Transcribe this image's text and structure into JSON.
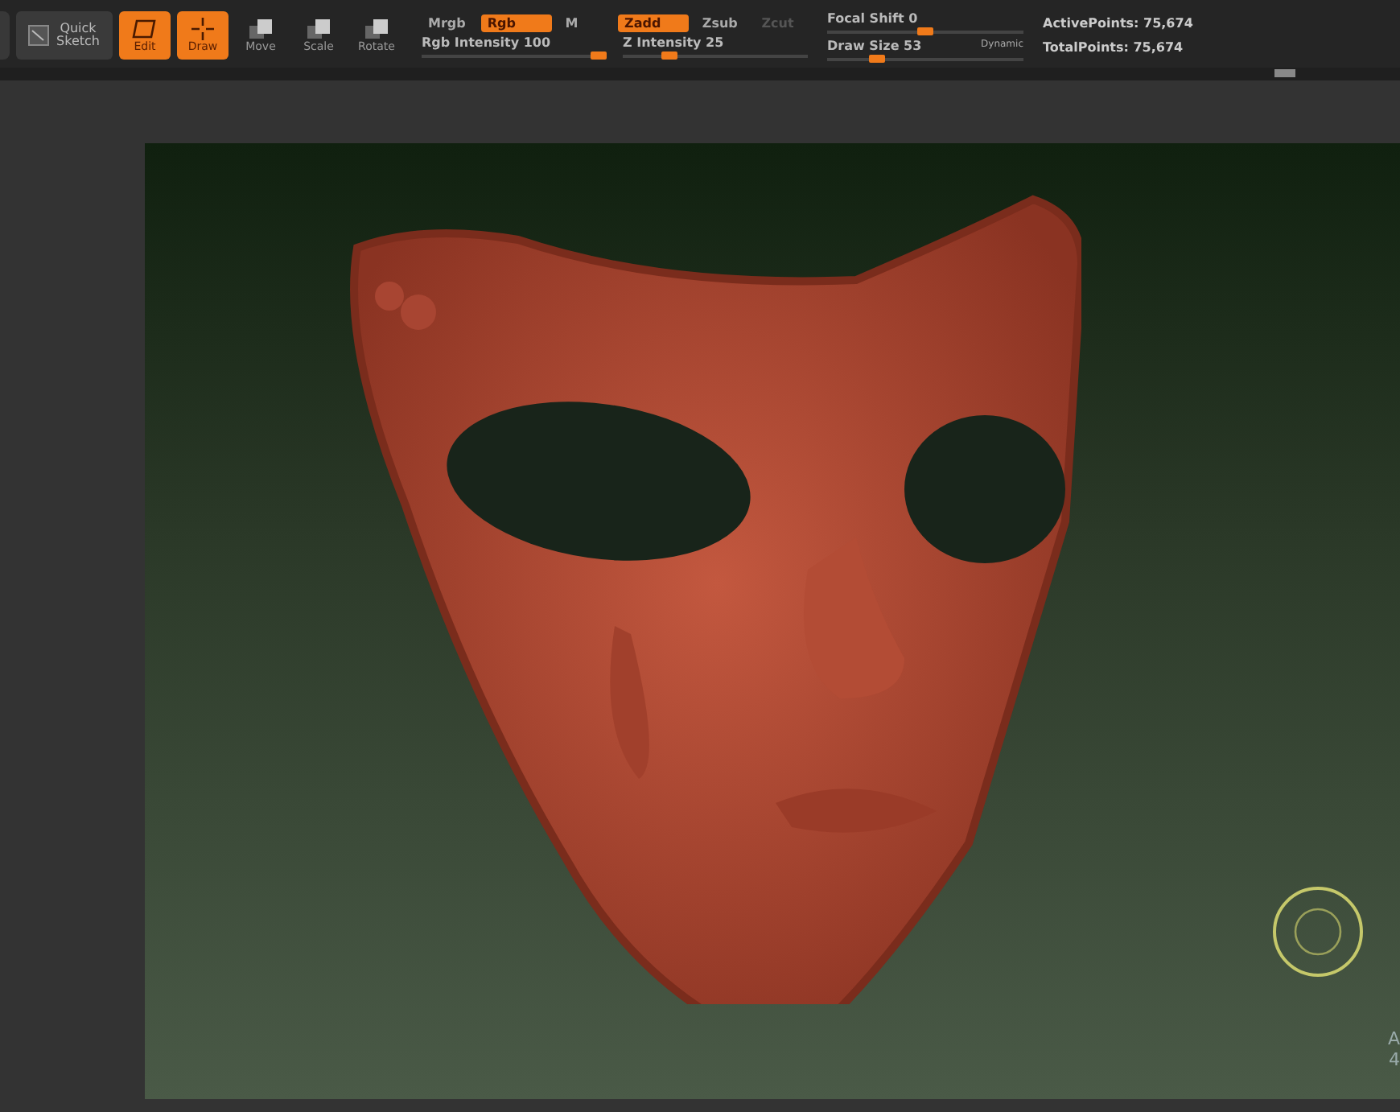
{
  "toolbar": {
    "tools": [
      {
        "label": "Quick Sketch",
        "kind": "sketch",
        "selected": false
      },
      {
        "label": "Edit",
        "kind": "edit",
        "selected": true
      },
      {
        "label": "Draw",
        "kind": "draw",
        "selected": true
      },
      {
        "label": "Move",
        "kind": "move",
        "selected": false
      },
      {
        "label": "Scale",
        "kind": "scale",
        "selected": false
      },
      {
        "label": "Rotate",
        "kind": "rotate",
        "selected": false
      }
    ],
    "color_modes": [
      {
        "label": "Mrgb",
        "selected": false
      },
      {
        "label": "Rgb",
        "selected": true
      },
      {
        "label": "M",
        "selected": false
      }
    ],
    "depth_modes": [
      {
        "label": "Zadd",
        "selected": true,
        "disabled": false
      },
      {
        "label": "Zsub",
        "selected": false,
        "disabled": false
      },
      {
        "label": "Zcut",
        "selected": false,
        "disabled": true
      }
    ],
    "sliders": [
      {
        "label": "Rgb Intensity 100",
        "level": 0.96
      },
      {
        "label": "Z Intensity 25",
        "level": 0.25
      },
      {
        "label": "Focal Shift 0",
        "level": 0.5
      },
      {
        "label": "Draw Size 53",
        "level": 0.25
      }
    ],
    "dynamic_button": "Dynamic",
    "stats": [
      "ActivePoints: 75,674",
      "TotalPoints: 75,674"
    ]
  },
  "viewport": {
    "edge_text": [
      "A",
      "4"
    ]
  }
}
